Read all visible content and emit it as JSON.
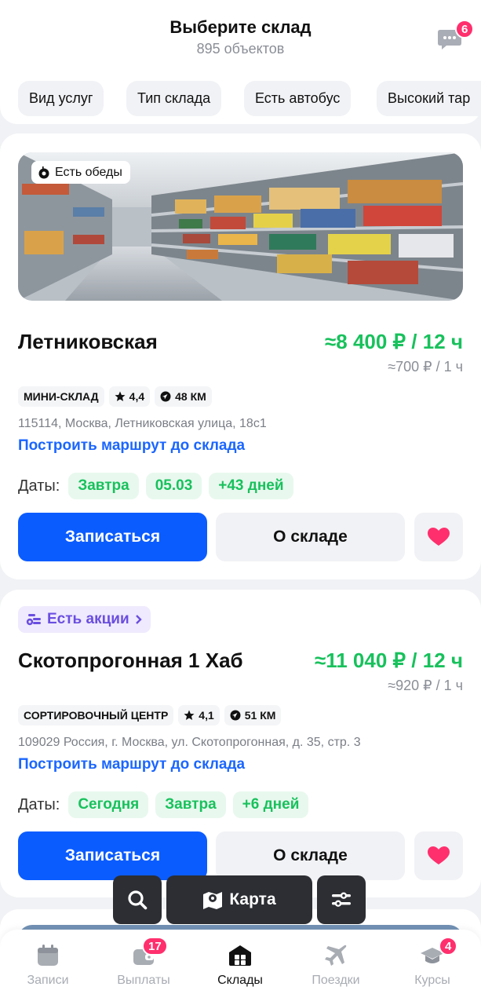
{
  "header": {
    "title": "Выберите склад",
    "subtitle": "895 объектов",
    "chat_badge": "6",
    "chat_icon": "chat-bubble-icon"
  },
  "filters": [
    "Вид услуг",
    "Тип склада",
    "Есть автобус",
    "Высокий тар"
  ],
  "warehouses": [
    {
      "photo_tag": "Есть обеды",
      "name": "Летниковская",
      "price": "≈8 400 ₽ / 12 ч",
      "price_hourly": "≈700 ₽ / 1 ч",
      "type": "МИНИ-СКЛАД",
      "rating": "4,4",
      "distance": "48 КМ",
      "address": "115114, Москва, Летниковская улица, 18с1",
      "route_link": "Построить маршрут до склада",
      "dates_label": "Даты:",
      "dates": [
        "Завтра",
        "05.03",
        "+43 дней"
      ],
      "signup_label": "Записаться",
      "about_label": "О складе"
    },
    {
      "promo": "Есть акции",
      "name": "Скотопрогонная 1 Хаб",
      "price": "≈11 040 ₽ / 12 ч",
      "price_hourly": "≈920 ₽ / 1 ч",
      "type": "СОРТИРОВОЧНЫЙ ЦЕНТР",
      "rating": "4,1",
      "distance": "51 КМ",
      "address": "109029 Россия, г. Москва, ул. Скотопрогонная, д. 35, стр. 3",
      "route_link": "Построить маршрут до склада",
      "dates_label": "Даты:",
      "dates": [
        "Сегодня",
        "Завтра",
        "+6 дней"
      ],
      "signup_label": "Записаться",
      "about_label": "О складе"
    }
  ],
  "floating": {
    "map_label": "Карта"
  },
  "tabbar": [
    {
      "label": "Записи",
      "icon": "calendar-icon",
      "badge": ""
    },
    {
      "label": "Выплаты",
      "icon": "wallet-icon",
      "badge": "17"
    },
    {
      "label": "Склады",
      "icon": "warehouse-icon",
      "badge": "",
      "active": true
    },
    {
      "label": "Поездки",
      "icon": "airplane-icon",
      "badge": ""
    },
    {
      "label": "Курсы",
      "icon": "graduation-cap-icon",
      "badge": "4"
    }
  ],
  "colors": {
    "accent": "#0b5cff",
    "price_green": "#18c15c",
    "badge_pink": "#ff2f6d",
    "promo_purple": "#6a4ee0",
    "heart": "#ff2f6d"
  }
}
